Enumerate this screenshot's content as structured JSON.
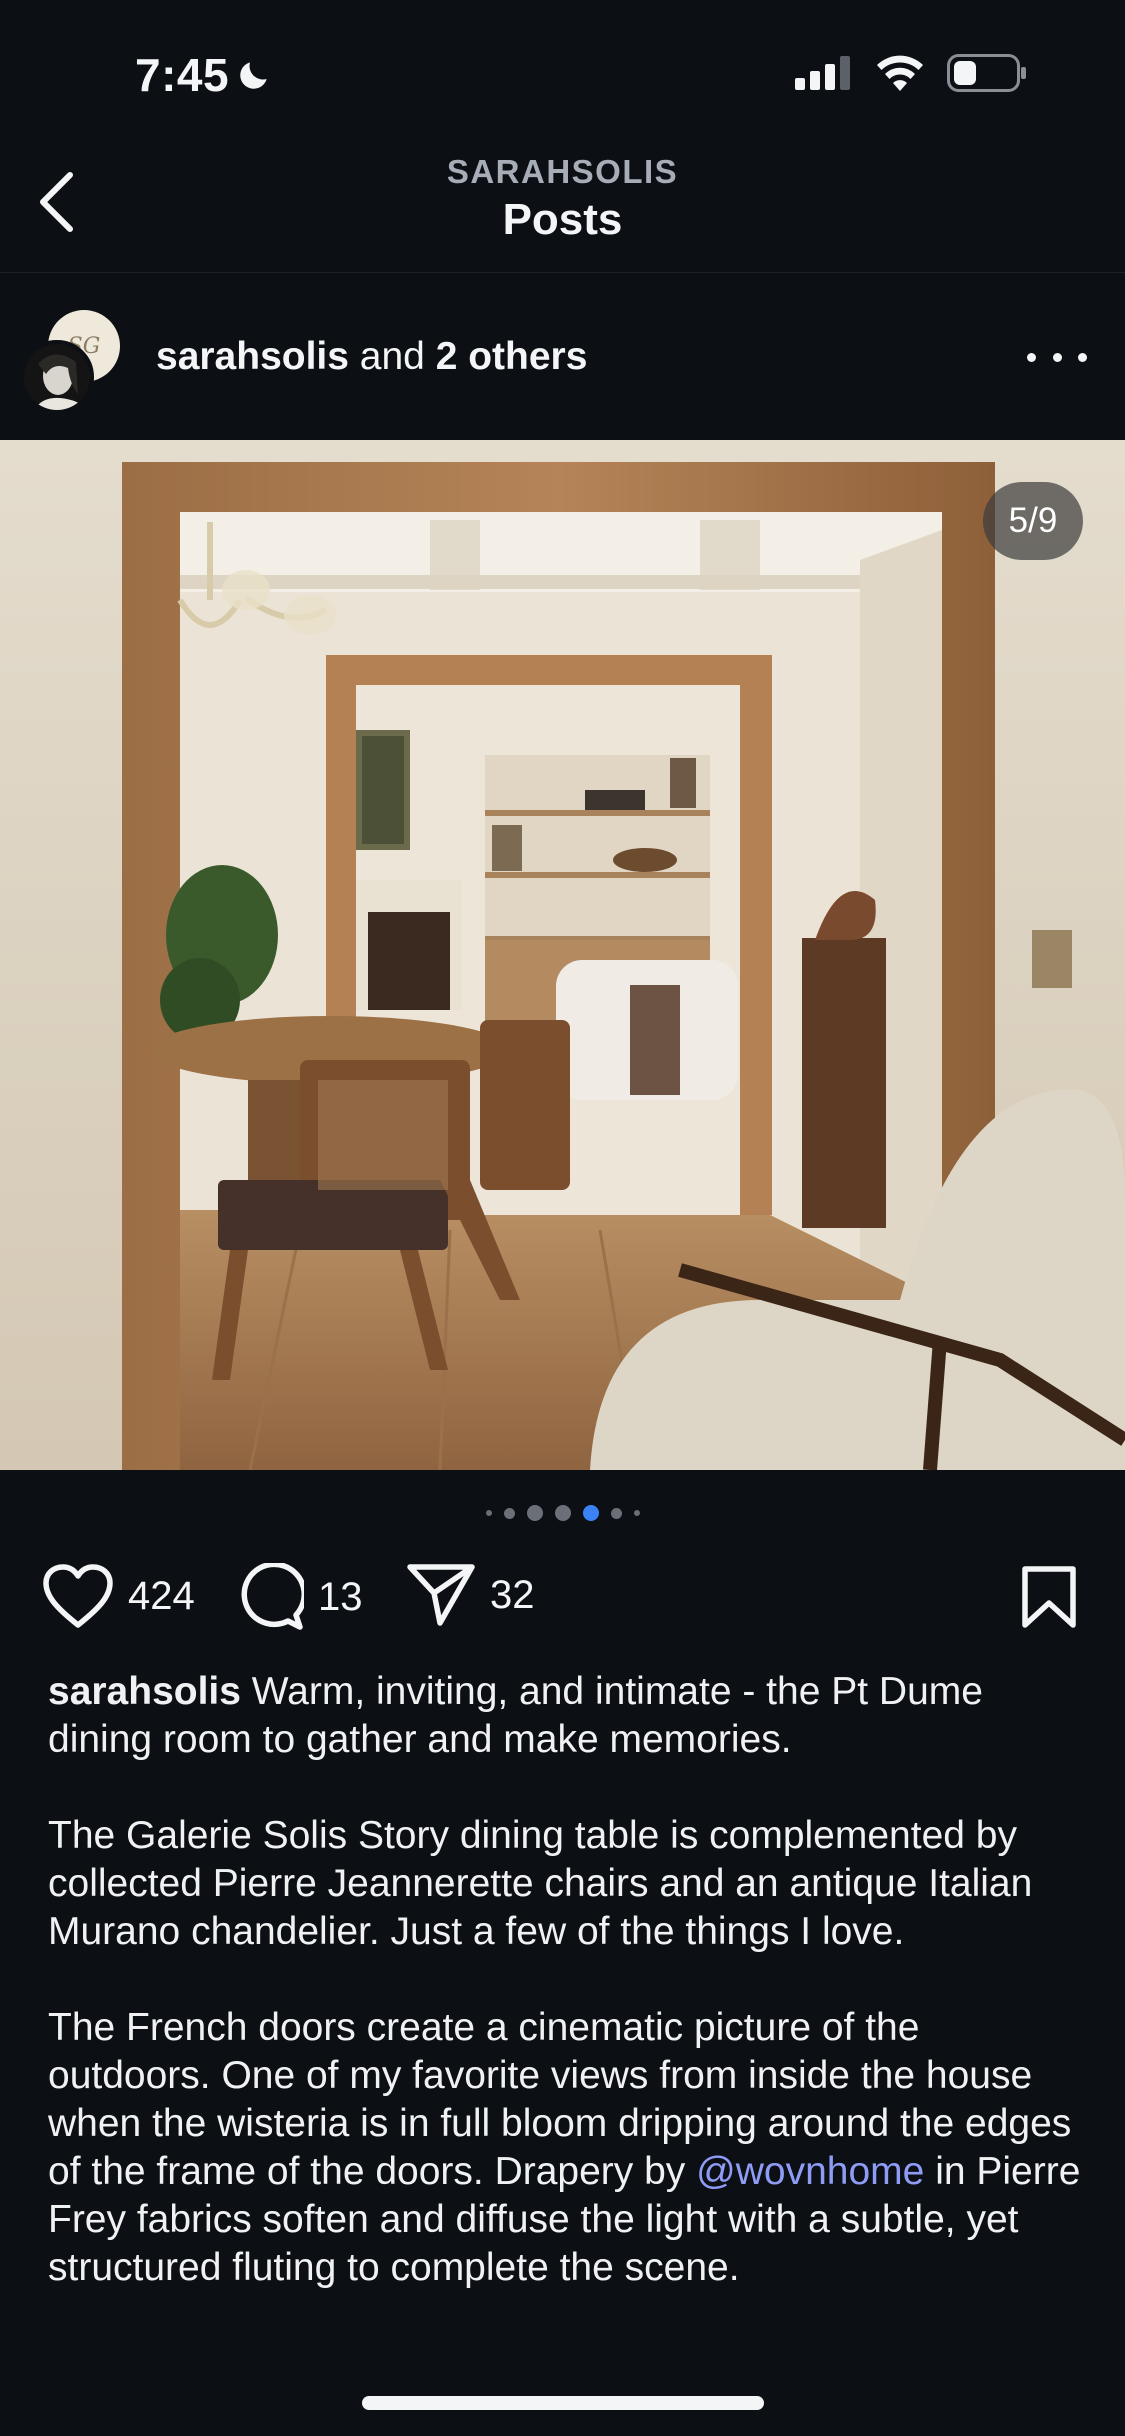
{
  "status_bar": {
    "time": "7:45",
    "moon_icon": "moon-icon",
    "icons": [
      "signal-icon",
      "wifi-icon",
      "battery-icon"
    ]
  },
  "nav": {
    "username": "SARAHSOLIS",
    "title": "Posts",
    "back_icon": "chevron-left-icon"
  },
  "post": {
    "owner": "sarahsolis",
    "owner_connector": " and ",
    "collaborators": "2 others",
    "avatar_mark": "SG",
    "more_icon": "more-horizontal-icon",
    "image_counter": "5/9",
    "carousel": {
      "total_dots": 7,
      "active_index": 4
    }
  },
  "actions": {
    "likes": "424",
    "comments": "13",
    "shares": "32",
    "icons": {
      "like": "heart-icon",
      "comment": "comment-icon",
      "share": "send-icon",
      "save": "bookmark-icon"
    }
  },
  "caption": {
    "username": "sarahsolis",
    "p1": " Warm, inviting, and intimate - the Pt Dume dining room to gather and make memories.",
    "p2": "The Galerie Solis Story dining table is complemented by collected Pierre Jeannerette chairs and an antique Italian Murano chandelier. Just a few of the things I love.",
    "p3_before": "The French doors create a cinematic picture of the outdoors. One of my favorite views from inside the house when the wisteria is in full bloom dripping around the edges of the frame of the doors. Drapery by ",
    "p3_mention": "@wovnhome",
    "p3_after": " in Pierre Frey fabrics soften and diffuse the light with a subtle, yet structured fluting to complete the scene."
  },
  "colors": {
    "background": "#0c0f14",
    "text": "#f4f5f7",
    "mention": "#8e9cf5",
    "active_dot": "#3b82f6"
  }
}
